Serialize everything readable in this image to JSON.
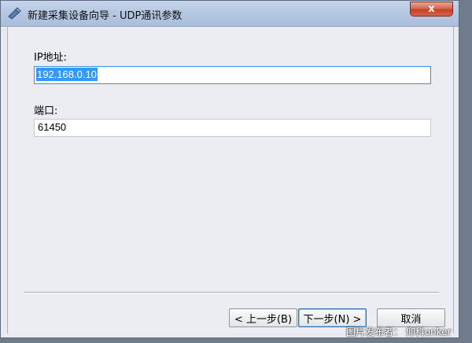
{
  "window": {
    "title": "新建采集设备向导 - UDP通讯参数",
    "close_label": "x"
  },
  "form": {
    "ip_label": "IP地址:",
    "ip_value": "192.168.0.10",
    "port_label": "端口:",
    "port_value": "61450"
  },
  "buttons": {
    "back_label": "< 上一步(B)",
    "next_label": "下一步(N) >",
    "cancel_label": "取消"
  },
  "watermark": "图片发布者： 仰科onker",
  "colors": {
    "titlebar": "#b6c8e1",
    "selection": "#3399ff",
    "close_button": "#c4402a"
  },
  "icons": {
    "app": "app-icon",
    "close": "close-icon"
  }
}
